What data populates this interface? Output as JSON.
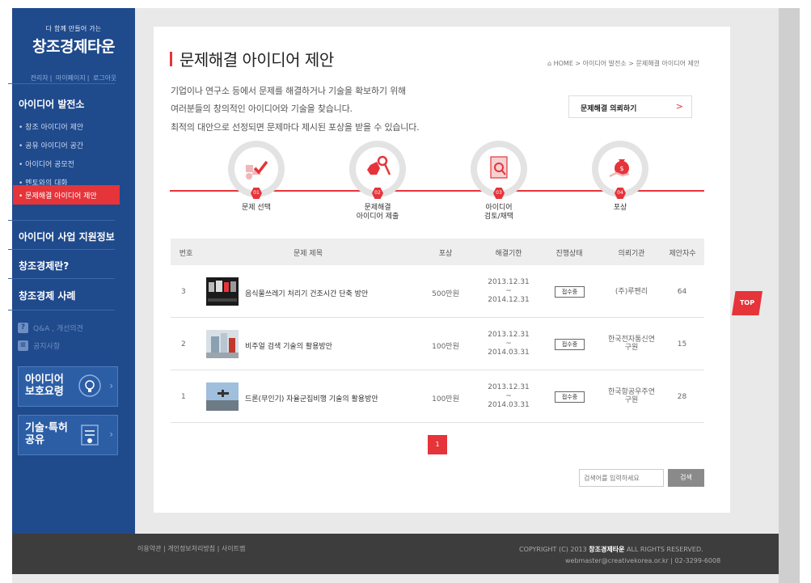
{
  "logo": {
    "tagline": "다 함께 만들어 가는",
    "name": "창조경제타운"
  },
  "util_links": [
    "전리자",
    "마이페이지",
    "로그아웃"
  ],
  "sidebar": {
    "section_idea": "아이디어 발전소",
    "sub_items": [
      "창조 아이디어 제안",
      "공유 아이디어 공간",
      "아이디어 공모전",
      "멘토와의 대화"
    ],
    "active_sub": "문제해결 아이디어 제안",
    "section_support": "아이디어 사업 지원정보",
    "section_about": "창조경제란?",
    "section_cases": "창조경제 사례",
    "qna_label": "Q&A , 개선의견",
    "notice_label": "공지사항",
    "banner_protect": "아이디어\n보호요령",
    "banner_share": "기술·특허\n공유"
  },
  "page": {
    "title": "문제해결 아이디어 제안",
    "breadcrumb": "⌂ HOME > 아이디어 발전소 > 문제해결 아이디어 제안",
    "intro_1": "기업이나 연구소 등에서 문제를 해결하거나 기술을 확보하기 위해",
    "intro_2": "여러분들의 창의적인 아이디어와 기술을 찾습니다.",
    "intro_3": "최적의 대안으로 선정되면 문제마다 제시된 포상을 받을 수 있습니다.",
    "request_btn": "문제해결 의뢰하기",
    "request_arrow": ">"
  },
  "steps": [
    {
      "num": "01",
      "label": "문제 선택"
    },
    {
      "num": "02",
      "label": "문제해결\n아이디어 제출"
    },
    {
      "num": "03",
      "label": "아이디어\n검토/채택"
    },
    {
      "num": "04",
      "label": "포상"
    }
  ],
  "table": {
    "headers": [
      "번호",
      "문제 제목",
      "포상",
      "해결기한",
      "진행상태",
      "의뢰기관",
      "제안자수"
    ],
    "rows": [
      {
        "no": "3",
        "title": "음식물쓰레기 처리기 건조시간 단축 방안",
        "reward": "500만원",
        "period_start": "2013.12.31",
        "tilde": "~",
        "period_end": "2014.12.31",
        "status": "접수중",
        "agency": "(주)루펜리",
        "count": "64"
      },
      {
        "no": "2",
        "title": "비주얼 검색 기술의 활용방안",
        "reward": "100만원",
        "period_start": "2013.12.31",
        "tilde": "~",
        "period_end": "2014.03.31",
        "status": "접수중",
        "agency": "한국전자통신연\n구원",
        "count": "15"
      },
      {
        "no": "1",
        "title": "드론(무인기) 자율군집비행 기술의 활용방안",
        "reward": "100만원",
        "period_start": "2013.12.31",
        "tilde": "~",
        "period_end": "2014.03.31",
        "status": "접수중",
        "agency": "한국항공우주연\n구원",
        "count": "28"
      }
    ]
  },
  "pager": {
    "current": "1"
  },
  "search": {
    "placeholder": "검색어를 입력하세요",
    "button": "검색"
  },
  "top_btn": "TOP",
  "footer": {
    "links": "이용약관 | 개인정보처리방침 | 사이트맵",
    "copy_pre": "COPYRIGHT (C) 2013",
    "copy_brand": "창조경제타운",
    "copy_post": "ALL RIGHTS RESERVED.",
    "mail": "webmaster@creativekorea.or.kr | 02-3299-6008"
  },
  "colors": {
    "brand_blue": "#1f4a8c",
    "accent_red": "#e5343a",
    "footer": "#3d3d3d"
  }
}
